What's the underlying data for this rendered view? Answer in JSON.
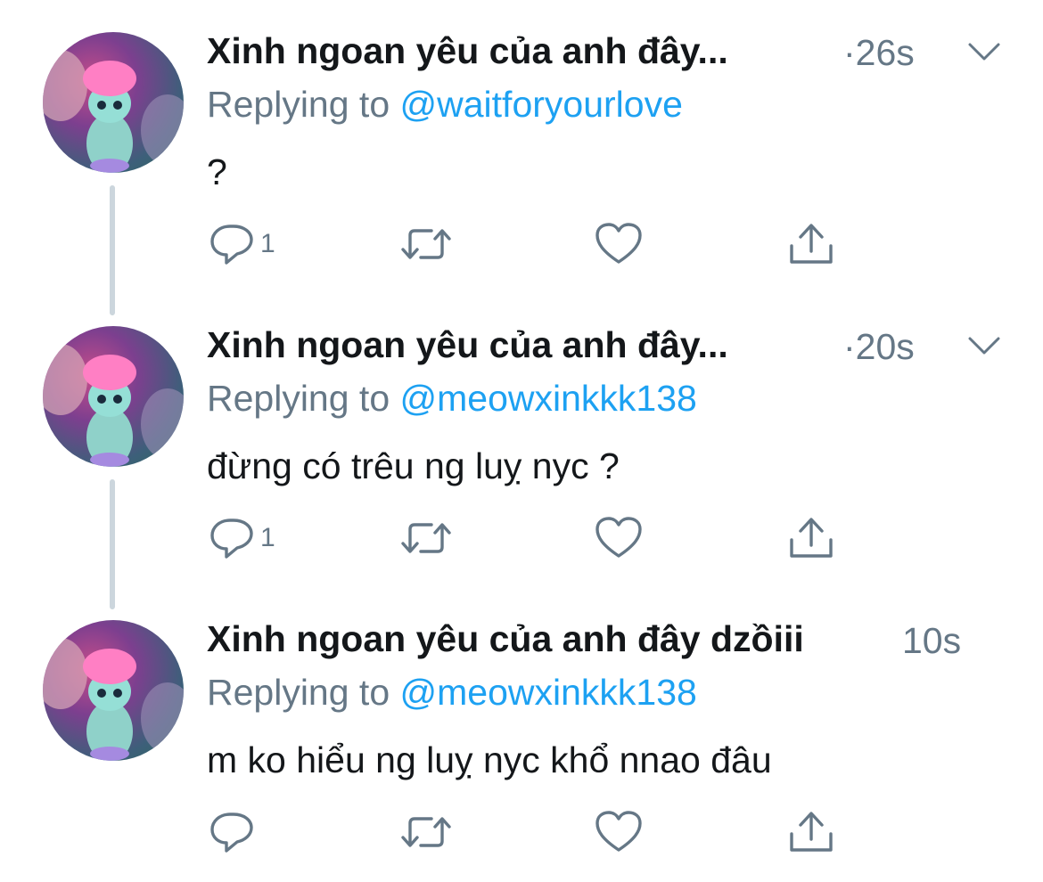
{
  "tweets": [
    {
      "author": "Xinh ngoan yêu của anh đây...",
      "time": "·26s",
      "replying_prefix": "Replying to ",
      "replying_handle": "@waitforyourlove",
      "text": "?",
      "reply_count": "1",
      "has_menu": true
    },
    {
      "author": "Xinh ngoan yêu của anh đây...",
      "time": "·20s",
      "replying_prefix": "Replying to ",
      "replying_handle": "@meowxinkkk138",
      "text": "đừng có trêu ng luỵ nyc ?",
      "reply_count": "1",
      "has_menu": true
    },
    {
      "author": "Xinh ngoan yêu của anh đây dzồiii",
      "time": "10s",
      "replying_prefix": "Replying to ",
      "replying_handle": "@meowxinkkk138",
      "text": "m ko hiểu ng luỵ nyc khổ nnao đâu",
      "reply_count": "",
      "has_menu": false
    }
  ],
  "icons": {
    "reply": "reply-icon",
    "retweet": "retweet-icon",
    "like": "heart-icon",
    "share": "share-icon",
    "menu": "chevron-down-icon"
  },
  "colors": {
    "link": "#1da1f2",
    "muted": "#657786",
    "text": "#14171a",
    "thread_line": "#ccd6dd"
  }
}
